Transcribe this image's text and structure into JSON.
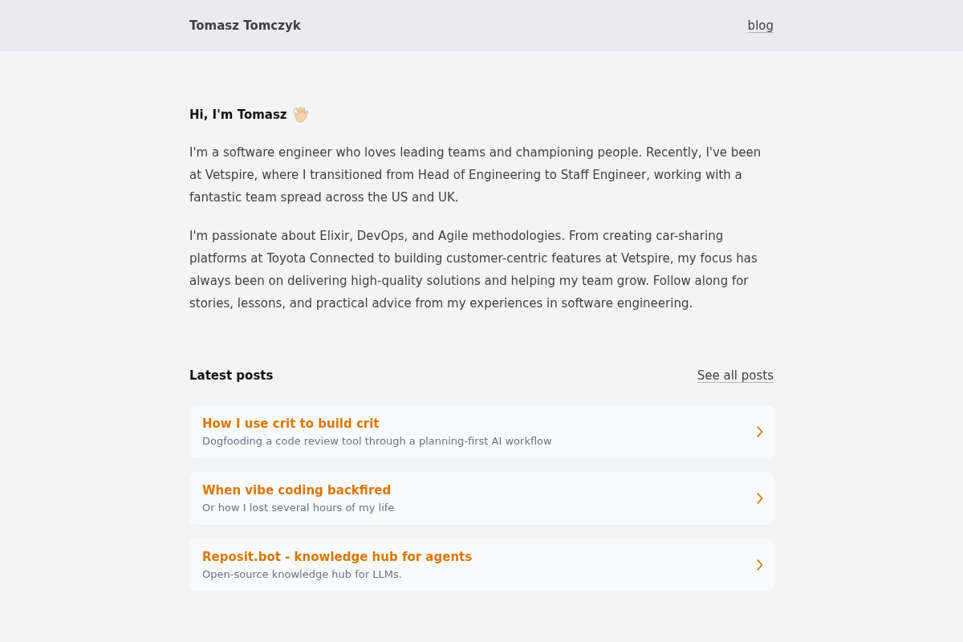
{
  "header": {
    "site_name": "Tomasz Tomczyk",
    "nav_links": [
      "blog"
    ]
  },
  "intro": {
    "greeting": "Hi, I'm Tomasz",
    "paragraphs": [
      "I'm a software engineer who loves leading teams and championing people. Recently, I've been at Vetspire, where I transitioned from Head of Engineering to Staff Engineer, working with a fantastic team spread across the US and UK.",
      "I'm passionate about Elixir, DevOps, and Agile methodologies. From creating car-sharing platforms at Toyota Connected to building customer-centric features at Vetspire, my focus has always been on delivering high-quality solutions and helping my team grow. Follow along for stories, lessons, and practical advice from my experiences in software engineering."
    ]
  },
  "latest_posts": {
    "heading": "Latest posts",
    "see_all_link": "See all posts",
    "posts": [
      {
        "title": "How I use crit to build crit",
        "summary": "Dogfooding a code review tool through a planning-first AI workflow"
      },
      {
        "title": "When vibe coding backfired",
        "summary": "Or how I lost several hours of my life"
      },
      {
        "title": "Reposit.bot - knowledge hub for agents",
        "summary": "Open-source knowledge hub for LLMs."
      }
    ]
  }
}
